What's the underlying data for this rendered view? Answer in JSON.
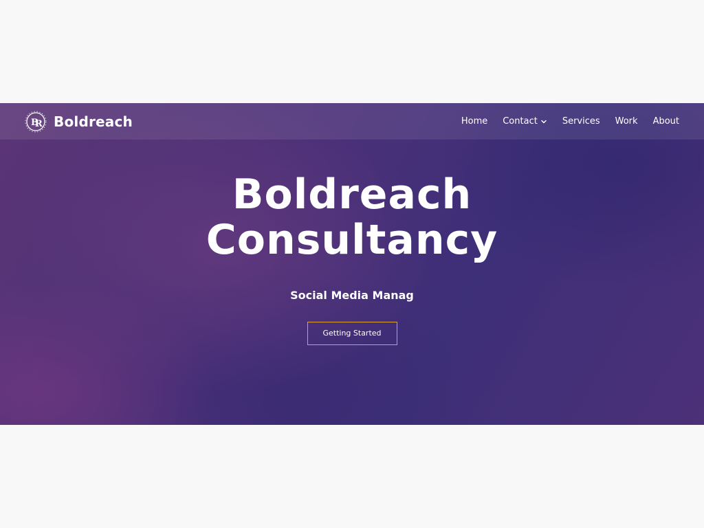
{
  "navbar": {
    "brand_name": "Boldreach",
    "logo_icon": "br-monogram-logo-icon",
    "items": [
      {
        "label": "Home"
      },
      {
        "label": "Contact",
        "has_dropdown": true
      },
      {
        "label": "Services"
      },
      {
        "label": "Work"
      },
      {
        "label": "About"
      }
    ]
  },
  "hero": {
    "title_line1": "Boldreach",
    "title_line2": "Consultancy",
    "subtitle": "Social Media Manag",
    "cta_label": "Getting Started"
  },
  "colors": {
    "background": "#f8f8f8",
    "hero_purple": "#4a3078",
    "text": "#ffffff",
    "button_border": "#e3a52c"
  }
}
